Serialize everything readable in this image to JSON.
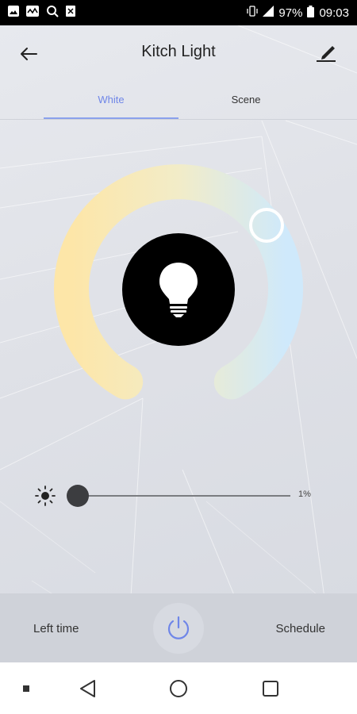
{
  "status_bar": {
    "battery": "97%",
    "time": "09:03"
  },
  "header": {
    "title": "Kitch Light"
  },
  "tabs": [
    {
      "label": "White"
    },
    {
      "label": "Scene"
    }
  ],
  "color_temperature": {
    "thumb_color": "#ffffff",
    "warm_color": "#fde6a8",
    "cool_color": "#cfe9fb"
  },
  "brightness": {
    "value_label": "1%",
    "value": 0.01
  },
  "bottom_bar": {
    "left_time_label": "Left time",
    "schedule_label": "Schedule"
  },
  "colors": {
    "accent": "#6f86e8",
    "power": "#6f86e8"
  }
}
